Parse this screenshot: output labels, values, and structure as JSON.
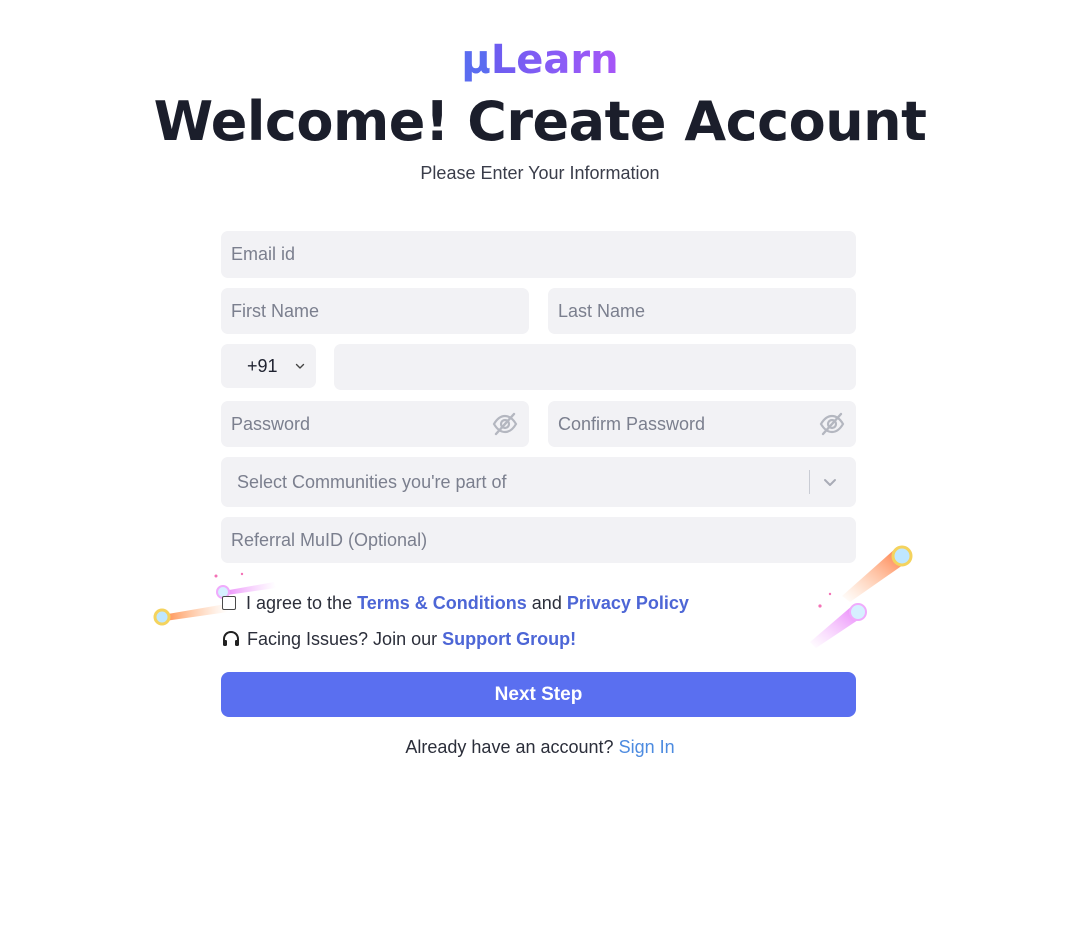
{
  "brand": {
    "logo_mu": "μ",
    "logo_rest": "Learn"
  },
  "header": {
    "title": "Welcome! Create Account",
    "subtitle": "Please Enter Your Information"
  },
  "form": {
    "email_placeholder": "Email id",
    "first_name_placeholder": "First Name",
    "last_name_placeholder": "Last Name",
    "country_code": "+91",
    "phone_value": "",
    "password_placeholder": "Password",
    "confirm_password_placeholder": "Confirm Password",
    "communities_placeholder": "Select Communities you're part of",
    "referral_placeholder": "Referral MuID (Optional)"
  },
  "agreement": {
    "prefix": "I agree to the",
    "terms_link": "Terms & Conditions",
    "and": "and",
    "privacy_link": "Privacy Policy",
    "checked": false
  },
  "support": {
    "prefix": "Facing Issues? Join our",
    "link": "Support Group!"
  },
  "actions": {
    "next_label": "Next Step",
    "signin_prompt": "Already have an account?",
    "signin_link": "Sign In"
  },
  "icons": {
    "password_toggle": "eye-off-icon",
    "dropdown": "chevron-down-icon",
    "support": "headset-icon",
    "decoration": "comet-icon"
  },
  "colors": {
    "primary": "#5a6ff0",
    "link": "#4d66d6",
    "signin_link": "#4d8be0",
    "input_bg": "#f2f2f5",
    "title": "#1b1e2b"
  }
}
